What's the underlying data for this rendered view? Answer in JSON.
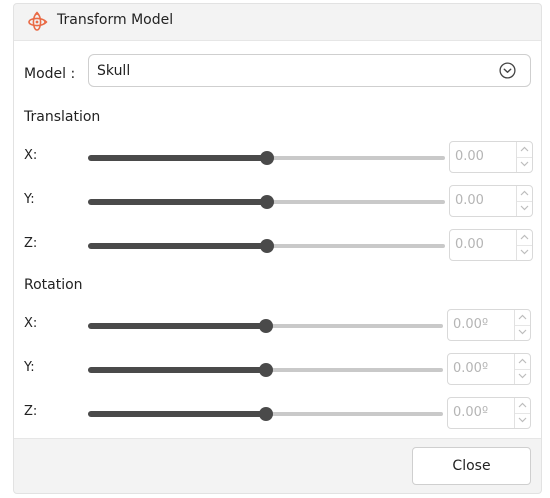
{
  "window": {
    "title": "Transform Model",
    "icon": "transform-axes-icon",
    "accent_color": "#e96a45"
  },
  "model": {
    "label": "Model :",
    "selected": "Skull",
    "icon": "chevron-down-circle-icon"
  },
  "translation": {
    "heading": "Translation",
    "rows": [
      {
        "axis": "X:",
        "value": "0.00",
        "slider_fraction": 0.5
      },
      {
        "axis": "Y:",
        "value": "0.00",
        "slider_fraction": 0.5
      },
      {
        "axis": "Z:",
        "value": "0.00",
        "slider_fraction": 0.5
      }
    ]
  },
  "rotation": {
    "heading": "Rotation",
    "rows": [
      {
        "axis": "X:",
        "value": "0.00º",
        "slider_fraction": 0.5
      },
      {
        "axis": "Y:",
        "value": "0.00º",
        "slider_fraction": 0.5
      },
      {
        "axis": "Z:",
        "value": "0.00º",
        "slider_fraction": 0.5
      }
    ]
  },
  "footer": {
    "close_label": "Close"
  }
}
